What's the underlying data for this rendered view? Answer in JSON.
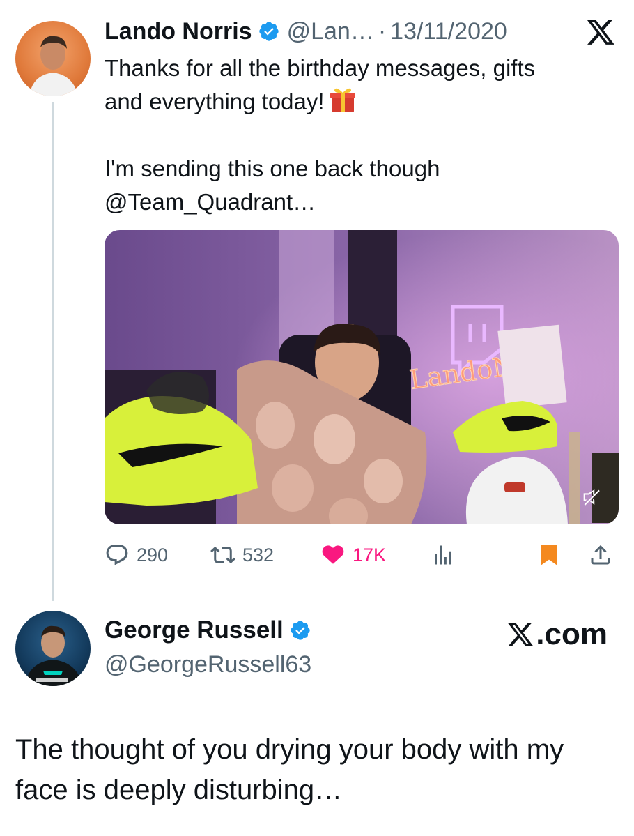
{
  "tweet": {
    "author": {
      "display_name": "Lando Norris",
      "handle": "@Lan…",
      "verified": true,
      "avatar_icon": "profile-photo"
    },
    "separator": "·",
    "date": "13/11/2020",
    "text_line1": "Thanks for all the birthday messages, gifts",
    "text_line2": "and everything today!",
    "emoji": "gift-emoji",
    "text_line3": "I'm sending this one back though",
    "text_line4": "@Team_Quadrant…",
    "media": {
      "type": "video",
      "muted": true,
      "neon_sign_text": "LandoNo"
    },
    "stats": {
      "replies": "290",
      "retweets": "532",
      "likes": "17K",
      "liked": true,
      "bookmarked": true
    }
  },
  "reply": {
    "author": {
      "display_name": "George Russell",
      "handle": "@GeorgeRussell63",
      "verified": true
    },
    "text_line1": "The thought of you drying your body with my",
    "text_line2": "face is deeply disturbing…"
  },
  "brand": {
    "xcom_label": ".com"
  },
  "colors": {
    "verified_blue": "#1d9bf0",
    "like_pink": "#f91880",
    "bookmark_orange": "#f4891f",
    "secondary_text": "#536471",
    "thread_line": "#cfd9de"
  }
}
